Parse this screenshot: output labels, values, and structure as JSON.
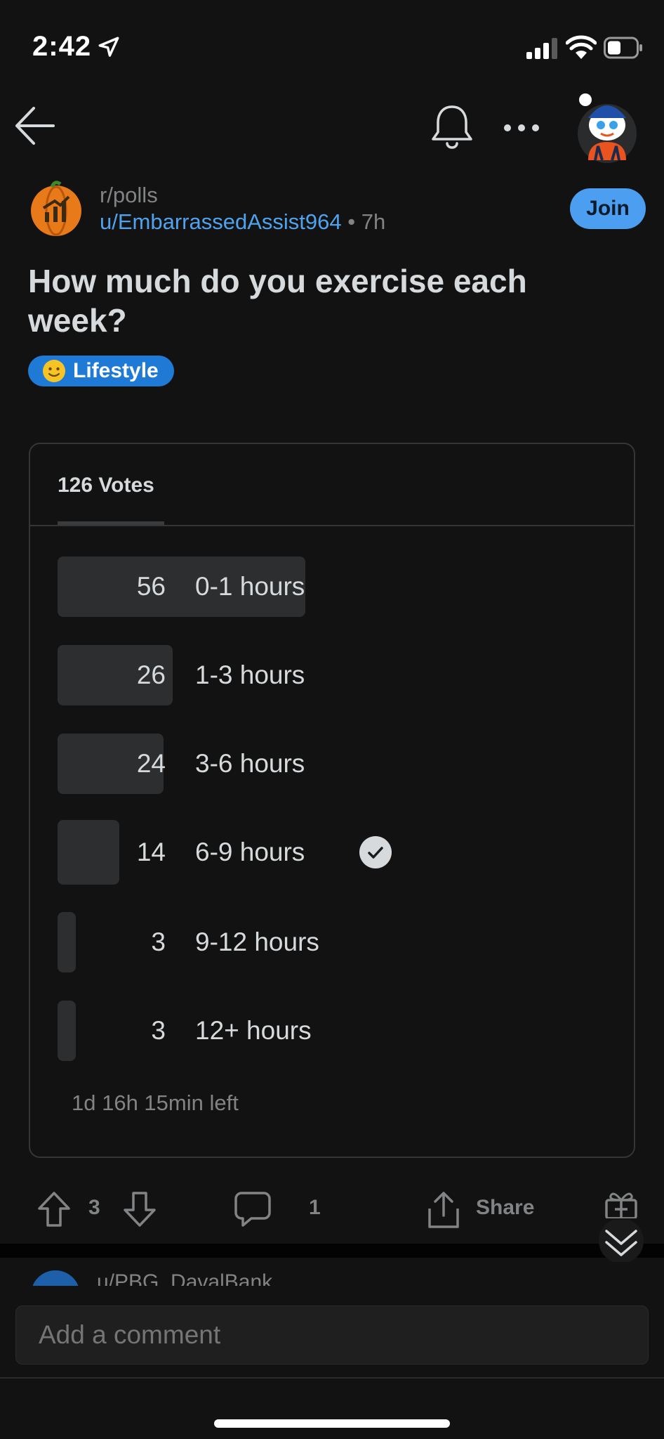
{
  "status_bar": {
    "time": "2:42"
  },
  "post": {
    "subreddit": "r/polls",
    "author": "u/EmbarrassedAssist964",
    "separator": "•",
    "age": "7h",
    "join_label": "Join",
    "title": "How much do you exercise each week?",
    "flair": {
      "emoji_icon": "slightly-smiling-face-icon",
      "label": "Lifestyle",
      "color": "#1f7ad6"
    }
  },
  "poll": {
    "total_votes_label": "126 Votes",
    "total_votes": 126,
    "options": [
      {
        "count": "56",
        "label": "0-1 hours",
        "votes": 56,
        "selected": false
      },
      {
        "count": "26",
        "label": "1-3 hours",
        "votes": 26,
        "selected": false
      },
      {
        "count": "24",
        "label": "3-6 hours",
        "votes": 24,
        "selected": false
      },
      {
        "count": "14",
        "label": "6-9 hours",
        "votes": 14,
        "selected": true
      },
      {
        "count": "3",
        "label": "9-12 hours",
        "votes": 3,
        "selected": false
      },
      {
        "count": "3",
        "label": "12+ hours",
        "votes": 3,
        "selected": false
      }
    ],
    "time_left": "1d 16h 15min left"
  },
  "actions": {
    "score": "3",
    "comments": "1",
    "share_label": "Share"
  },
  "next_comment_peek": {
    "author": "u/PBG_DavalBank"
  },
  "comment_box": {
    "placeholder": "Add a comment"
  },
  "colors": {
    "background": "#121212",
    "accent": "#4b9ef0",
    "link": "#4fa3ee",
    "muted": "#818384",
    "bar": "#2c2e30"
  }
}
